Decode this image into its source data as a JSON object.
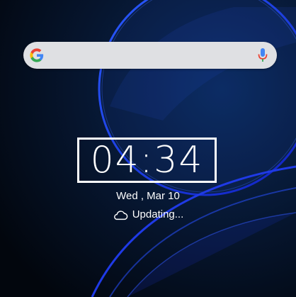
{
  "colors": {
    "background": "#000000",
    "search_bar": "#dfe0e3",
    "accent_blue": "#1e3df0",
    "text": "#ffffff"
  },
  "search": {
    "logo_icon": "google-g-icon",
    "mic_icon": "microphone-icon"
  },
  "clock": {
    "time": "04:34"
  },
  "date": {
    "label": "Wed , Mar 10"
  },
  "weather": {
    "icon": "cloud-icon",
    "status": "Updating..."
  }
}
